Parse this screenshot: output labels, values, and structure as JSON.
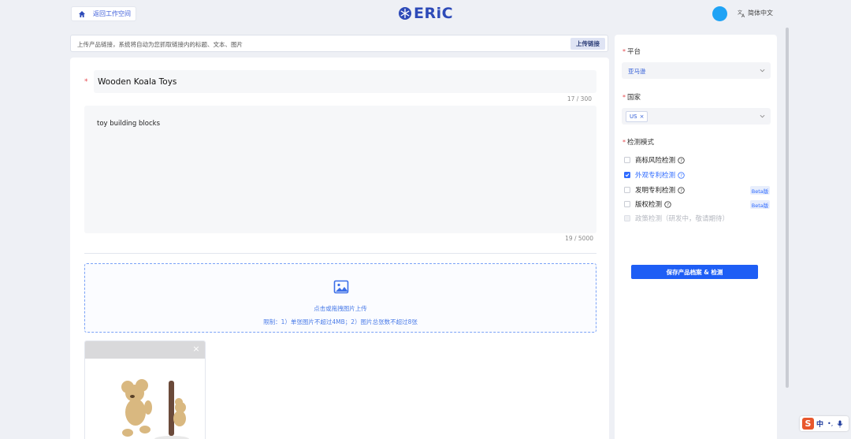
{
  "header": {
    "back_label": "返回工作空间",
    "logo_text": "ERiC",
    "language": "简体中文"
  },
  "url_bar": {
    "placeholder": "上传产品链接，系统将自动为您抓取链接内的标题、文本、图片",
    "button_label": "上传链接"
  },
  "product": {
    "required_mark": "*",
    "title": "Wooden Koala Toys",
    "title_count": "17 / 300",
    "description": "toy building blocks",
    "description_count": "19 / 5000",
    "upload_text": "点击或拖拽图片上传",
    "upload_limit": "限制：1）单张图片不超过4MB；2）图片总张数不超过8张",
    "thumbnail_close": "×"
  },
  "settings": {
    "platform_label": "平台",
    "platform_value": "亚马逊",
    "country_label": "国家",
    "country_tag": "US",
    "country_tag_remove": "×",
    "mode_label": "检测模式",
    "options": [
      {
        "label": "商标风险检测",
        "checked": false,
        "disabled": false,
        "help": true,
        "beta": ""
      },
      {
        "label": "外观专利检测",
        "checked": true,
        "disabled": false,
        "help": true,
        "beta": ""
      },
      {
        "label": "发明专利检测",
        "checked": false,
        "disabled": false,
        "help": true,
        "beta": "Beta版"
      },
      {
        "label": "版权检测",
        "checked": false,
        "disabled": false,
        "help": true,
        "beta": "Beta版"
      },
      {
        "label": "政策检测（研发中，敬请期待）",
        "checked": false,
        "disabled": true,
        "help": false,
        "beta": ""
      }
    ],
    "save_button": "保存产品档案 & 检测"
  },
  "ime": {
    "logo": "S",
    "mode": "中",
    "punct": "•,"
  },
  "colors": {
    "accent": "#1e5ef5",
    "logo": "#2d4ab8",
    "required": "#e5484d",
    "avatar": "#1fa3f5"
  }
}
